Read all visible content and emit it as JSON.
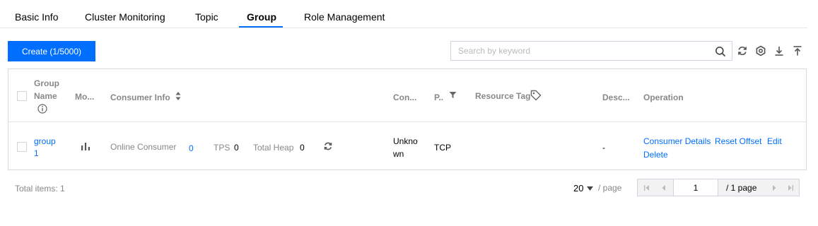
{
  "tabs": [
    {
      "label": "Basic Info"
    },
    {
      "label": "Cluster Monitoring"
    },
    {
      "label": "Topic"
    },
    {
      "label": "Group",
      "active": true
    },
    {
      "label": "Role Management"
    }
  ],
  "toolbar": {
    "create_label": "Create (1/5000)",
    "search_placeholder": "Search by keyword",
    "icons": [
      "search-icon",
      "refresh-icon",
      "settings-icon",
      "download-icon",
      "upload-icon"
    ]
  },
  "table": {
    "headers": {
      "group_name_line1": "Group",
      "group_name_line2": "Name",
      "monitoring": "Mo...",
      "consumer_info": "Consumer Info",
      "consumer": "Con...",
      "protocol": "P..",
      "resource_tag": "Resource Tag",
      "description": "Desc...",
      "operation": "Operation"
    },
    "rows": [
      {
        "group_line1": "group",
        "group_line2": "1",
        "online_consumer_label": "Online Consumer",
        "online_consumer_value": "0",
        "tps_label": "TPS",
        "tps_value": "0",
        "total_heap_label": "Total Heap",
        "total_heap_value": "0",
        "consumer_line1": "Unkno",
        "consumer_line2": "wn",
        "protocol": "TCP",
        "description": "-",
        "actions": {
          "consumer_details": "Consumer Details",
          "reset_offset": "Reset Offset",
          "edit": "Edit",
          "delete": "Delete"
        }
      }
    ]
  },
  "footer": {
    "total_items": "Total items: 1",
    "page_size": "20",
    "per_page": "/ page",
    "current_page": "1",
    "total_pages": "/ 1 page"
  },
  "colors": {
    "accent": "#006eff",
    "muted_text": "#888888",
    "border": "#d9d9d9"
  }
}
